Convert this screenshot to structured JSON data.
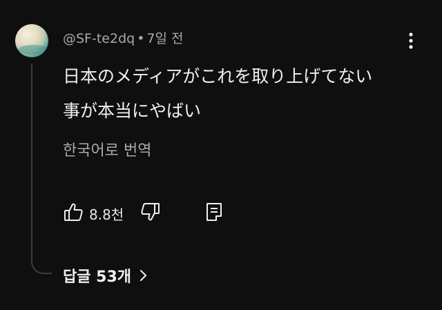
{
  "comment": {
    "author": "@SF-te2dq",
    "separator": "•",
    "timestamp": "7일 전",
    "text_line1": "日本のメディアがこれを取り上げてない",
    "text_line2": "事が本当にやばい",
    "translate_label": "한국어로 번역"
  },
  "actions": {
    "like_count": "8.8천"
  },
  "replies": {
    "label": "답글 53개"
  },
  "icons": {
    "more": "more-vert-icon",
    "like": "thumb-up-icon",
    "dislike": "thumb-down-icon",
    "reply": "comment-icon",
    "chevron": "chevron-right-icon"
  },
  "colors": {
    "background": "#0f0f0f",
    "text_primary": "#f1f1f1",
    "text_secondary": "#aaaaaa",
    "thread_line": "#3d3d3d"
  }
}
